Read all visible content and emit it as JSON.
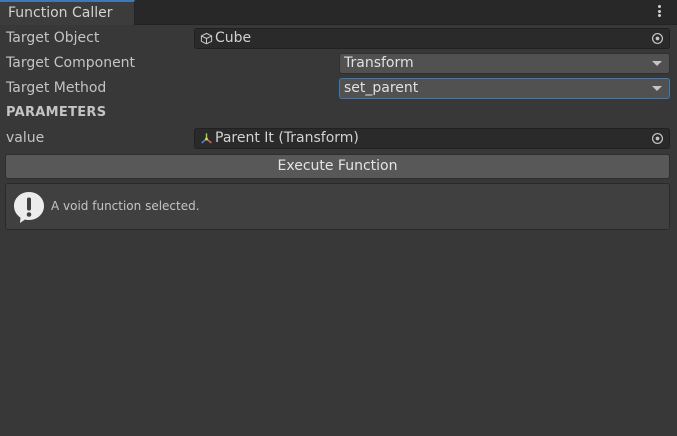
{
  "window": {
    "tab_title": "Function Caller",
    "menu_icon": "kebab-menu-icon"
  },
  "fields": {
    "target_object": {
      "label": "Target Object",
      "value": "Cube",
      "icon": "cube-icon"
    },
    "target_component": {
      "label": "Target Component",
      "value": "Transform"
    },
    "target_method": {
      "label": "Target Method",
      "value": "set_parent"
    }
  },
  "parameters": {
    "heading": "PARAMETERS",
    "value": {
      "label": "value",
      "value": "Parent It (Transform)",
      "icon": "transform-icon"
    }
  },
  "actions": {
    "execute_label": "Execute Function"
  },
  "help": {
    "icon": "info-exclamation-icon",
    "message": "A void function selected."
  },
  "colors": {
    "background": "#383838",
    "accent": "#3a79bb",
    "field_bg": "#2a2a2a",
    "dropdown_bg": "#515151",
    "button_bg": "#585858"
  }
}
